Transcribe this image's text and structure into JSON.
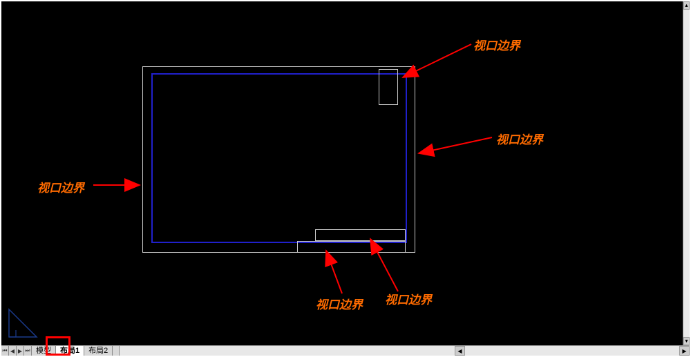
{
  "annotations": {
    "top": "视口边界",
    "right": "视口边界",
    "left": "视口边界",
    "bottom_left": "视口边界",
    "bottom_right": "视口边界"
  },
  "tabs": {
    "model": "模型",
    "layout1": "布局1",
    "layout2": "布局2"
  },
  "nav": {
    "first": "⏮",
    "prev": "◀",
    "next": "▶",
    "last": "⏭"
  },
  "scroll": {
    "left": "◀",
    "right": "▶",
    "up": "▲",
    "down": "▼"
  },
  "colors": {
    "annotation": "#ff6b00",
    "arrow": "#ff0000",
    "viewport": "#2020cc",
    "paper": "#cccccc"
  }
}
